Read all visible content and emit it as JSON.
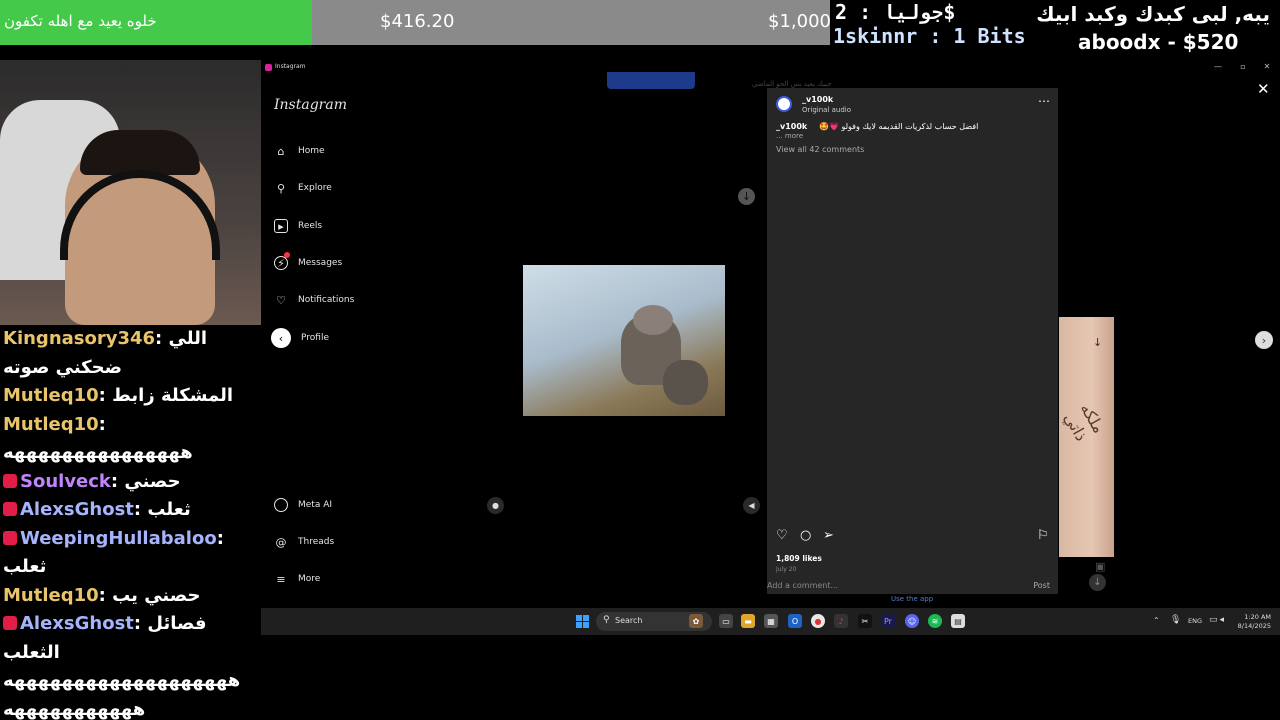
{
  "stream_overlay": {
    "goal_message": "خلوه يعيد مع اهله تكفون",
    "goal_current": "$416.20",
    "goal_target": "$1,000",
    "goal_progress": 0.416,
    "alert_donation_line": "جوليا : 2$",
    "alert_bits_line": "1skinnr : 1 Bits",
    "alert_message_line": "يبه, لبى كبدك وكبد ابيك",
    "alert_donor_line": "aboodx - $520"
  },
  "chat": {
    "messages": [
      {
        "user": "Kingnasory346",
        "text": "اللي"
      },
      {
        "user": "",
        "text": "ضحكني صوته"
      },
      {
        "user": "Mutleq10",
        "text": "المشكلة زابط"
      },
      {
        "user": "Mutleq10",
        "text": ""
      },
      {
        "user": "",
        "text": "هههههههههههههههه"
      },
      {
        "user": "Soulveck",
        "text": "حصني"
      },
      {
        "user": "AlexsGhost",
        "text": "ثعلب"
      },
      {
        "user": "WeepingHullabaloo",
        "text": ""
      },
      {
        "user": "",
        "text": "ثعلب"
      },
      {
        "user": "Mutleq10",
        "text": "حصني يب"
      },
      {
        "user": "AlexsGhost",
        "text": "فصائل"
      },
      {
        "user": "",
        "text": "الثعلب"
      },
      {
        "user": "",
        "text": "هههههههههههههههههههه"
      },
      {
        "user": "",
        "text": "هههههههههههه"
      }
    ]
  },
  "window": {
    "title": "Instagram",
    "minimize": "—",
    "maximize": "▫",
    "close": "✕"
  },
  "instagram": {
    "logo": "Instagram",
    "nav": {
      "home": "Home",
      "explore": "Explore",
      "reels": "Reels",
      "messages": "Messages",
      "notifications": "Notifications",
      "profile": "Profile",
      "meta_ai": "Meta AI",
      "threads": "Threads",
      "more": "More"
    },
    "background_text": "جيبك يعيد بس الجو الماضي",
    "post": {
      "username": "_v100k",
      "audio": "Original audio",
      "caption_user": "_v100k",
      "caption": "افضل حساب لذكريات القديمه لايك وفولو 💗🤩",
      "more": "... more",
      "view_comments": "View all 42 comments",
      "likes": "1,809 likes",
      "date": "July 20",
      "add_comment_placeholder": "Add a comment...",
      "post_button": "Post"
    },
    "use_app": "Use the app",
    "next_thumb_text": "ملكه ذاتي"
  },
  "taskbar": {
    "search_label": "Search",
    "language": "ENG",
    "time": "1:20 AM",
    "date": "8/14/2025"
  }
}
